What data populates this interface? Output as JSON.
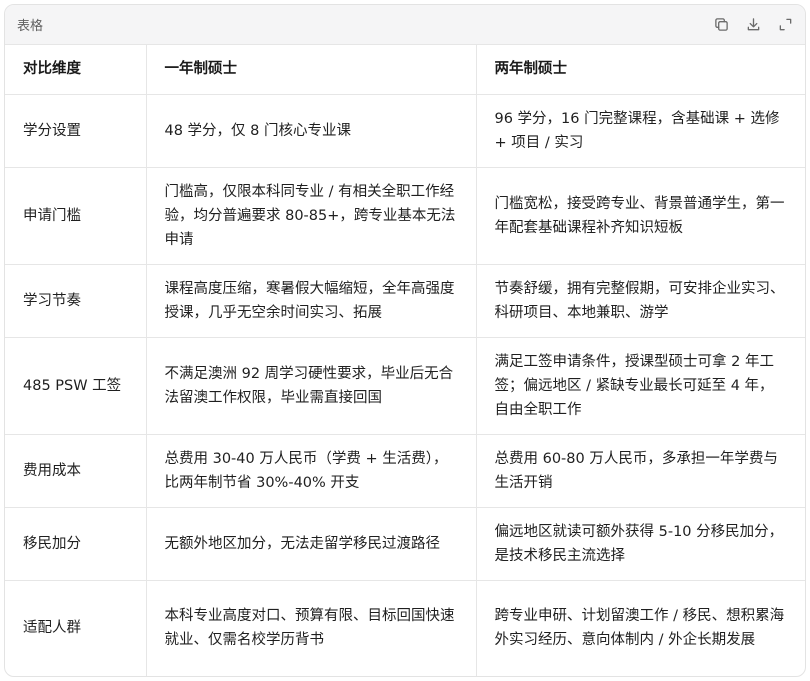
{
  "header": {
    "title": "表格",
    "icons": [
      "copy-icon",
      "download-icon",
      "expand-icon"
    ]
  },
  "table": {
    "columns": [
      "对比维度",
      "一年制硕士",
      "两年制硕士"
    ],
    "rows": [
      [
        "学分设置",
        "48 学分，仅 8 门核心专业课",
        "96 学分，16 门完整课程，含基础课 + 选修 + 项目 / 实习"
      ],
      [
        "申请门槛",
        "门槛高，仅限本科同专业 / 有相关全职工作经验，均分普遍要求 80-85+，跨专业基本无法申请",
        "门槛宽松，接受跨专业、背景普通学生，第一年配套基础课程补齐知识短板"
      ],
      [
        "学习节奏",
        "课程高度压缩，寒暑假大幅缩短，全年高强度授课，几乎无空余时间实习、拓展",
        "节奏舒缓，拥有完整假期，可安排企业实习、科研项目、本地兼职、游学"
      ],
      [
        "485 PSW 工签",
        "不满足澳洲 92 周学习硬性要求，毕业后无合法留澳工作权限，毕业需直接回国",
        "满足工签申请条件，授课型硕士可拿 2 年工签；偏远地区 / 紧缺专业最长可延至 4 年，自由全职工作"
      ],
      [
        "费用成本",
        "总费用 30-40 万人民币（学费 + 生活费），比两年制节省 30%-40% 开支",
        "总费用 60-80 万人民币，多承担一年学费与生活开销"
      ],
      [
        "移民加分",
        "无额外地区加分，无法走留学移民过渡路径",
        "偏远地区就读可额外获得 5-10 分移民加分，是技术移民主流选择"
      ],
      [
        "适配人群",
        "本科专业高度对口、预算有限、目标回国快速就业、仅需名校学历背书",
        "跨专业申研、计划留澳工作 / 移民、想积累海外实习经历、意向体制内 / 外企长期发展"
      ]
    ]
  }
}
